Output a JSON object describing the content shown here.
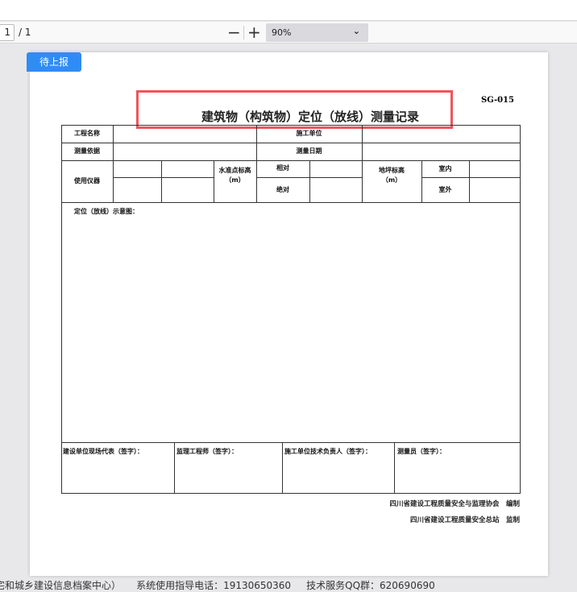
{
  "toolbar": {
    "page_current": "1",
    "page_total": "/ 1",
    "zoom_out": "−",
    "zoom_in": "+",
    "zoom_value": "90%",
    "chevron": "⌄"
  },
  "badge": "待上报",
  "document": {
    "code": "SG-015",
    "title": "建筑物（构筑物）定位（放线）测量记录",
    "labels": {
      "project_name": "工程名称",
      "construction_unit": "施工单位",
      "basis": "测量依据",
      "date": "测量日期",
      "instrument": "使用仪器",
      "benchmark": "水准点标高（m）",
      "relative": "相对",
      "absolute": "绝对",
      "floor": "地坪标高（m）",
      "indoor": "室内",
      "outdoor": "室外",
      "diagram": "定位（放线）示意图："
    },
    "signatures": [
      "建设单位现场代表（签字）：",
      "监理工程师（签字）：",
      "施工单位技术负责人（签字）：",
      "测量员（签字）："
    ],
    "org1": "四川省建设工程质量安全与监理协会　编制",
    "org2": "四川省建设工程质量安全总站　监制"
  },
  "footer": "宅和城乡建设信息档案中心）     系统使用指导电话：19130650360     技术服务QQ群：620690690"
}
